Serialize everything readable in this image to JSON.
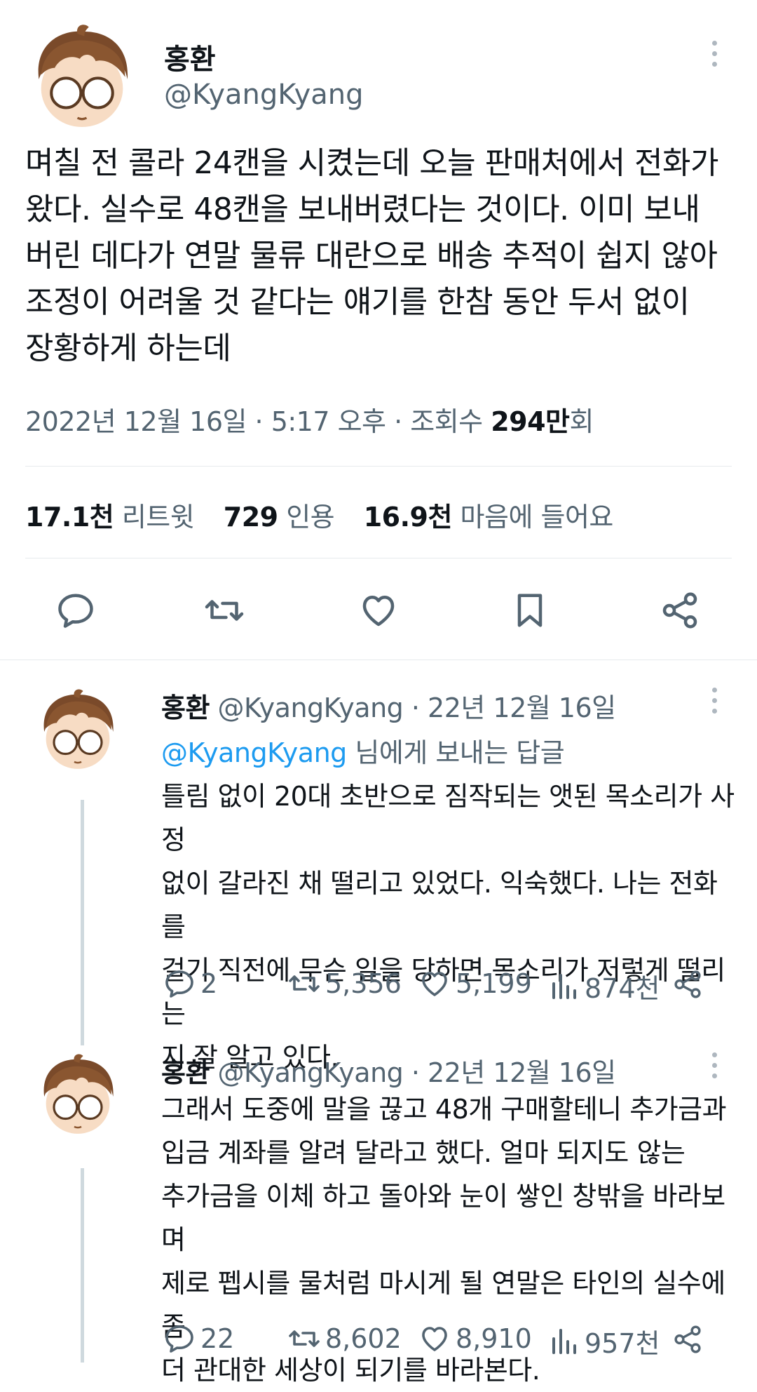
{
  "main": {
    "author_name": "홍환",
    "author_handle": "@KyangKyang",
    "text": "며칠 전 콜라 24캔을 시켰는데 오늘 판매처에서 전화가\n왔다. 실수로 48캔을 보내버렸다는 것이다. 이미 보내\n버린 데다가 연말 물류 대란으로 배송 추적이 쉽지 않아\n조정이 어려울 것 같다는 얘기를 한참 동안 두서 없이\n장황하게 하는데",
    "date": "2022년 12월 16일 · 5:17 오후 · 조회수 ",
    "views_count": "294만",
    "views_suffix": "회",
    "retweets_count": "17.1천",
    "retweets_label": "리트윗",
    "quotes_count": "729",
    "quotes_label": "인용",
    "likes_count": "16.9천",
    "likes_label": "마음에 들어요"
  },
  "replies": [
    {
      "author_name": "홍환",
      "handle_date": "@KyangKyang · 22년 12월 16일",
      "reply_to_mention": "@KyangKyang",
      "reply_to_suffix": " 님에게 보내는 답글",
      "text": "틀림 없이 20대 초반으로 짐작되는 앳된 목소리가 사정\n없이 갈라진 채 떨리고 있었다. 익숙했다. 나는 전화를\n걸기 직전에 무슨 일을 당하면 목소리가 저렇게 떨리는\n지 잘 알고 있다.",
      "replies": "2",
      "retweets": "5,356",
      "likes": "5,199",
      "views": "874천"
    },
    {
      "author_name": "홍환",
      "handle_date": "@KyangKyang · 22년 12월 16일",
      "text": "그래서 도중에 말을 끊고 48개 구매할테니 추가금과\n입금 계좌를 알려 달라고 했다. 얼마 되지도 않는\n추가금을 이체 하고 돌아와 눈이 쌓인 창밖을 바라보며\n제로 펩시를 물처럼 마시게 될 연말은 타인의 실수에 좀\n더 관대한 세상이 되기를 바라본다.",
      "replies": "22",
      "retweets": "8,602",
      "likes": "8,910",
      "views": "957천"
    }
  ],
  "colors": {
    "accent": "#1d9bf0",
    "secondary_text": "#536471",
    "divider": "#e7eaed"
  }
}
